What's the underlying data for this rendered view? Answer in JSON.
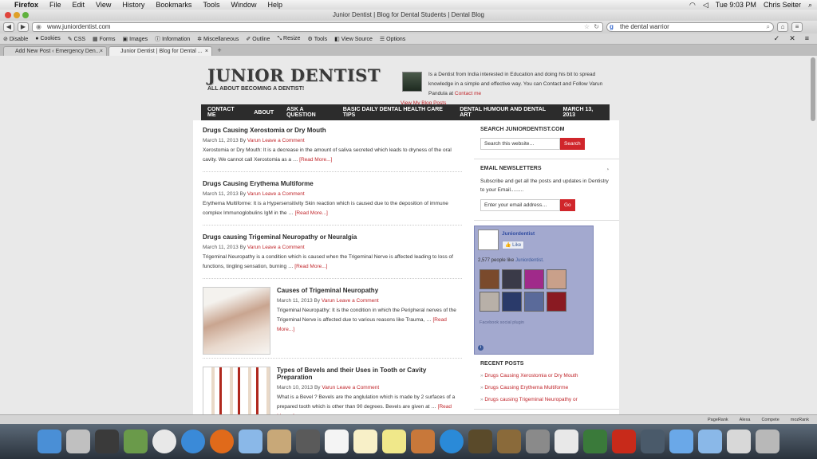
{
  "menubar": {
    "app": "Firefox",
    "items": [
      "File",
      "Edit",
      "View",
      "History",
      "Bookmarks",
      "Tools",
      "Window",
      "Help"
    ],
    "clock": "Tue 9:03 PM",
    "user": "Chris Seiter"
  },
  "window": {
    "title": "Junior Dentist | Blog for Dental Students | Dental Blog"
  },
  "navbar": {
    "url": "www.juniordentist.com",
    "search_value": "the dental warrior"
  },
  "devbar": {
    "items": [
      "Disable",
      "Cookies",
      "CSS",
      "Forms",
      "Images",
      "Information",
      "Miscellaneous",
      "Outline",
      "Resize",
      "Tools",
      "View Source",
      "Options"
    ]
  },
  "tabs": [
    {
      "label": "Add New Post ‹ Emergency Den..."
    },
    {
      "label": "Junior Dentist | Blog for Dental ..."
    }
  ],
  "site": {
    "logo": "JUNIOR DENTIST",
    "tagline": "ALL ABOUT BECOMING A DENTIST!",
    "bio": "Is a Dentist from India interested in Education and doing his bit to spread knowledge in a simple and effective way. You can Contact and Follow Varun Pandula at ",
    "contact_link": "Contact me",
    "view_posts": "View My Blog Posts"
  },
  "nav": {
    "items": [
      "CONTACT ME",
      "ABOUT",
      "ASK A QUESTION",
      "BASIC DAILY DENTAL HEALTH CARE TIPS",
      "DENTAL HUMOUR AND DENTAL ART"
    ],
    "date": "MARCH 13, 2013"
  },
  "posts": [
    {
      "title": "Drugs Causing Xerostomia or Dry Mouth",
      "date": "March 11, 2013 By",
      "author": "Varun",
      "comment": "Leave a Comment",
      "excerpt": "Xerostomia or Dry Mouth: It is a decrease in the amount of saliva secreted which leads to dryness of the oral cavity. We cannot call Xerostomia as a …",
      "more": "[Read More...]"
    },
    {
      "title": "Drugs Causing Erythema Multiforme",
      "date": "March 11, 2013 By",
      "author": "Varun",
      "comment": "Leave a Comment",
      "excerpt": "Erythema Multiforme: It is a Hypersensitivity Skin reaction which is caused due to the deposition of immune complex Immunoglobulins IgM in the …",
      "more": "[Read More...]"
    },
    {
      "title": "Drugs causing Trigeminal Neuropathy or Neuralgia",
      "date": "March 11, 2013 By",
      "author": "Varun",
      "comment": "Leave a Comment",
      "excerpt": "Trigeminal Neuropathy is a condition which is caused when the Trigeminal Nerve is affected leading to loss of functions, tingling sensation, burning …",
      "more": "[Read More...]"
    },
    {
      "title": "Causes of Trigeminal Neuropathy",
      "date": "March 11, 2013 By",
      "author": "Varun",
      "comment": "Leave a Comment",
      "excerpt": "Trigeminal Neuropathy: It is the condition in which the Peripheral nerves of the Trigeminal Nerve is affected due to various reasons like Trauma, …",
      "more": "[Read More...]"
    },
    {
      "title": "Types of Bevels and their Uses in Tooth or Cavity Preparation",
      "date": "March 10, 2013 By",
      "author": "Varun",
      "comment": "Leave a Comment",
      "excerpt": "What is a Bevel ? Bevels are the anglulation which is made by 2 surfaces of a prepared tooth which is other than 90 degrees. Bevels are given at …",
      "more": "[Read More...]"
    }
  ],
  "sidebar": {
    "search_title": "SEARCH JUNIORDENTIST.COM",
    "search_placeholder": "Search this website…",
    "search_btn": "Search",
    "news_title": "EMAIL NEWSLETTERS",
    "news_text": "Subscribe and get all the posts and updates in Dentistry to your Email.........",
    "email_placeholder": "Enter your email address…",
    "go_btn": "Go",
    "fb_name": "Juniordentist",
    "fb_like": "Like",
    "fb_count": "2,577 people like",
    "fb_count_link": "Juniordentist.",
    "fb_plugin": "Facebook social plugin",
    "recent_title": "RECENT POSTS",
    "recent": [
      "Drugs Causing Xerostomia or Dry Mouth",
      "Drugs Causing Erythema Multiforme",
      "Drugs causing Trigeminal Neuropathy or"
    ]
  },
  "statusbar": [
    "PageRank",
    "Alexa",
    "Compete",
    "mozRank"
  ],
  "colors": {
    "accent": "#c0262b",
    "nav_bg": "#2c2c2c",
    "fb_bg": "#a3a9cf"
  }
}
